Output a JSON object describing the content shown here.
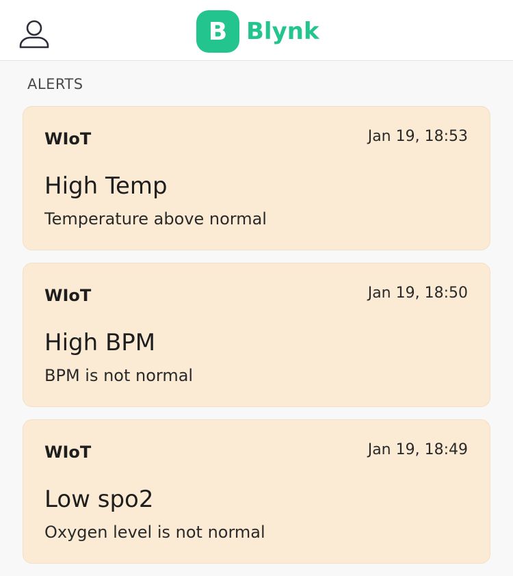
{
  "header": {
    "logo_letter": "B",
    "app_name": "Blynk",
    "brand_color": "#23c48e",
    "profile_icon": "user-icon"
  },
  "section": {
    "title": "ALERTS"
  },
  "alerts": [
    {
      "source": "WIoT",
      "time": "Jan 19, 18:53",
      "title": "High Temp",
      "message": "Temperature above normal"
    },
    {
      "source": "WIoT",
      "time": "Jan 19, 18:50",
      "title": "High BPM",
      "message": "BPM is not normal"
    },
    {
      "source": "WIoT",
      "time": "Jan 19, 18:49",
      "title": "Low spo2",
      "message": "Oxygen level is not normal"
    }
  ],
  "colors": {
    "card_background": "#fbebd4",
    "page_background": "#f8f8f8"
  }
}
